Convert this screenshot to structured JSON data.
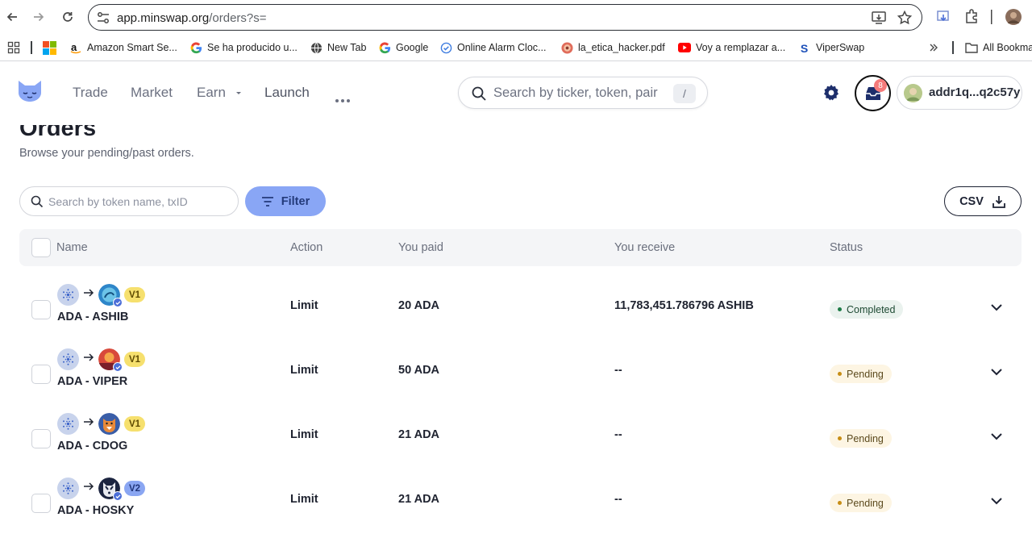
{
  "browser": {
    "url_host": "app.minswap.org",
    "url_rest": "/orders?s=",
    "bookmarks": [
      {
        "label": "Amazon Smart Se...",
        "icon": "amazon-icon"
      },
      {
        "label": "Se ha producido u...",
        "icon": "google-icon"
      },
      {
        "label": "New Tab",
        "icon": "globe-icon"
      },
      {
        "label": "Google",
        "icon": "google-icon"
      },
      {
        "label": "Online Alarm Cloc...",
        "icon": "alarm-check-icon"
      },
      {
        "label": "la_etica_hacker.pdf",
        "icon": "pdf-icon"
      },
      {
        "label": "Voy a remplazar a...",
        "icon": "youtube-icon"
      },
      {
        "label": "ViperSwap",
        "icon": "viperswap-icon"
      }
    ],
    "all_bookmarks": "All Bookmarks"
  },
  "header": {
    "nav": [
      "Trade",
      "Market",
      "Earn",
      "Launch"
    ],
    "search_placeholder": "Search by ticker, token, pair",
    "search_shortcut": "/",
    "notifications": "8",
    "wallet_address": "addr1q...q2c57y",
    "brand_color": "#89a6f5"
  },
  "page": {
    "title": "Orders",
    "subtitle": "Browse your pending/past orders.",
    "search_placeholder": "Search by token name, txID",
    "filter_label": "Filter",
    "csv_label": "CSV"
  },
  "table": {
    "columns": {
      "name": "Name",
      "action": "Action",
      "paid": "You paid",
      "receive": "You receive",
      "status": "Status"
    },
    "rows": [
      {
        "pair": "ADA - ASHIB",
        "version": "V1",
        "action": "Limit",
        "paid": "20 ADA",
        "receive": "11,783,451.786796 ASHIB",
        "status": "Completed",
        "status_type": "completed",
        "token_icon": "ashib-token-icon"
      },
      {
        "pair": "ADA - VIPER",
        "version": "V1",
        "action": "Limit",
        "paid": "50 ADA",
        "receive": "--",
        "status": "Pending",
        "status_type": "pending",
        "token_icon": "viper-token-icon"
      },
      {
        "pair": "ADA - CDOG",
        "version": "V1",
        "action": "Limit",
        "paid": "21 ADA",
        "receive": "--",
        "status": "Pending",
        "status_type": "pending",
        "token_icon": "cdog-token-icon"
      },
      {
        "pair": "ADA - HOSKY",
        "version": "V2",
        "action": "Limit",
        "paid": "21 ADA",
        "receive": "--",
        "status": "Pending",
        "status_type": "pending",
        "token_icon": "hosky-token-icon"
      }
    ]
  }
}
